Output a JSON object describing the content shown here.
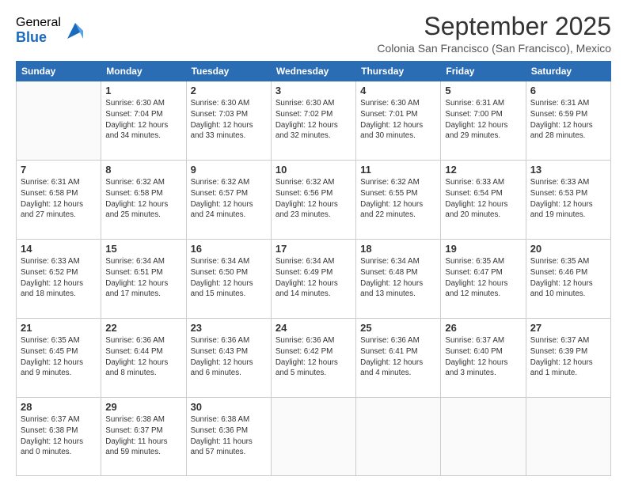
{
  "logo": {
    "general": "General",
    "blue": "Blue"
  },
  "title": "September 2025",
  "subtitle": "Colonia San Francisco (San Francisco), Mexico",
  "days_header": [
    "Sunday",
    "Monday",
    "Tuesday",
    "Wednesday",
    "Thursday",
    "Friday",
    "Saturday"
  ],
  "weeks": [
    [
      {
        "day": "",
        "info": ""
      },
      {
        "day": "1",
        "info": "Sunrise: 6:30 AM\nSunset: 7:04 PM\nDaylight: 12 hours\nand 34 minutes."
      },
      {
        "day": "2",
        "info": "Sunrise: 6:30 AM\nSunset: 7:03 PM\nDaylight: 12 hours\nand 33 minutes."
      },
      {
        "day": "3",
        "info": "Sunrise: 6:30 AM\nSunset: 7:02 PM\nDaylight: 12 hours\nand 32 minutes."
      },
      {
        "day": "4",
        "info": "Sunrise: 6:30 AM\nSunset: 7:01 PM\nDaylight: 12 hours\nand 30 minutes."
      },
      {
        "day": "5",
        "info": "Sunrise: 6:31 AM\nSunset: 7:00 PM\nDaylight: 12 hours\nand 29 minutes."
      },
      {
        "day": "6",
        "info": "Sunrise: 6:31 AM\nSunset: 6:59 PM\nDaylight: 12 hours\nand 28 minutes."
      }
    ],
    [
      {
        "day": "7",
        "info": "Sunrise: 6:31 AM\nSunset: 6:58 PM\nDaylight: 12 hours\nand 27 minutes."
      },
      {
        "day": "8",
        "info": "Sunrise: 6:32 AM\nSunset: 6:58 PM\nDaylight: 12 hours\nand 25 minutes."
      },
      {
        "day": "9",
        "info": "Sunrise: 6:32 AM\nSunset: 6:57 PM\nDaylight: 12 hours\nand 24 minutes."
      },
      {
        "day": "10",
        "info": "Sunrise: 6:32 AM\nSunset: 6:56 PM\nDaylight: 12 hours\nand 23 minutes."
      },
      {
        "day": "11",
        "info": "Sunrise: 6:32 AM\nSunset: 6:55 PM\nDaylight: 12 hours\nand 22 minutes."
      },
      {
        "day": "12",
        "info": "Sunrise: 6:33 AM\nSunset: 6:54 PM\nDaylight: 12 hours\nand 20 minutes."
      },
      {
        "day": "13",
        "info": "Sunrise: 6:33 AM\nSunset: 6:53 PM\nDaylight: 12 hours\nand 19 minutes."
      }
    ],
    [
      {
        "day": "14",
        "info": "Sunrise: 6:33 AM\nSunset: 6:52 PM\nDaylight: 12 hours\nand 18 minutes."
      },
      {
        "day": "15",
        "info": "Sunrise: 6:34 AM\nSunset: 6:51 PM\nDaylight: 12 hours\nand 17 minutes."
      },
      {
        "day": "16",
        "info": "Sunrise: 6:34 AM\nSunset: 6:50 PM\nDaylight: 12 hours\nand 15 minutes."
      },
      {
        "day": "17",
        "info": "Sunrise: 6:34 AM\nSunset: 6:49 PM\nDaylight: 12 hours\nand 14 minutes."
      },
      {
        "day": "18",
        "info": "Sunrise: 6:34 AM\nSunset: 6:48 PM\nDaylight: 12 hours\nand 13 minutes."
      },
      {
        "day": "19",
        "info": "Sunrise: 6:35 AM\nSunset: 6:47 PM\nDaylight: 12 hours\nand 12 minutes."
      },
      {
        "day": "20",
        "info": "Sunrise: 6:35 AM\nSunset: 6:46 PM\nDaylight: 12 hours\nand 10 minutes."
      }
    ],
    [
      {
        "day": "21",
        "info": "Sunrise: 6:35 AM\nSunset: 6:45 PM\nDaylight: 12 hours\nand 9 minutes."
      },
      {
        "day": "22",
        "info": "Sunrise: 6:36 AM\nSunset: 6:44 PM\nDaylight: 12 hours\nand 8 minutes."
      },
      {
        "day": "23",
        "info": "Sunrise: 6:36 AM\nSunset: 6:43 PM\nDaylight: 12 hours\nand 6 minutes."
      },
      {
        "day": "24",
        "info": "Sunrise: 6:36 AM\nSunset: 6:42 PM\nDaylight: 12 hours\nand 5 minutes."
      },
      {
        "day": "25",
        "info": "Sunrise: 6:36 AM\nSunset: 6:41 PM\nDaylight: 12 hours\nand 4 minutes."
      },
      {
        "day": "26",
        "info": "Sunrise: 6:37 AM\nSunset: 6:40 PM\nDaylight: 12 hours\nand 3 minutes."
      },
      {
        "day": "27",
        "info": "Sunrise: 6:37 AM\nSunset: 6:39 PM\nDaylight: 12 hours\nand 1 minute."
      }
    ],
    [
      {
        "day": "28",
        "info": "Sunrise: 6:37 AM\nSunset: 6:38 PM\nDaylight: 12 hours\nand 0 minutes."
      },
      {
        "day": "29",
        "info": "Sunrise: 6:38 AM\nSunset: 6:37 PM\nDaylight: 11 hours\nand 59 minutes."
      },
      {
        "day": "30",
        "info": "Sunrise: 6:38 AM\nSunset: 6:36 PM\nDaylight: 11 hours\nand 57 minutes."
      },
      {
        "day": "",
        "info": ""
      },
      {
        "day": "",
        "info": ""
      },
      {
        "day": "",
        "info": ""
      },
      {
        "day": "",
        "info": ""
      }
    ]
  ]
}
